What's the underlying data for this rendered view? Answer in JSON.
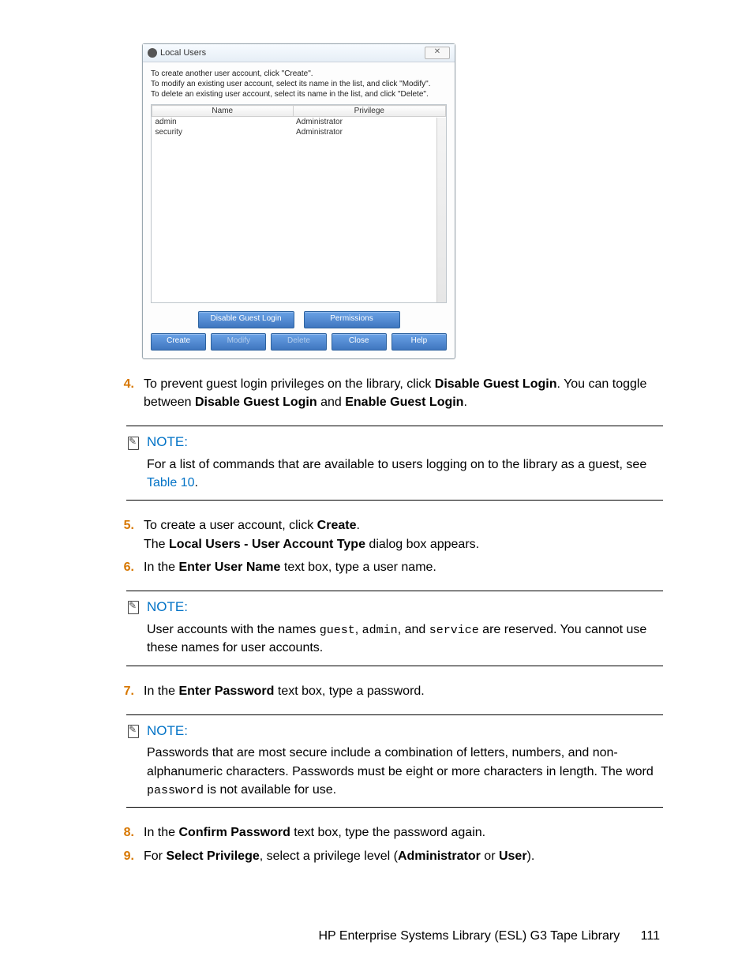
{
  "dialog": {
    "title": "Local Users",
    "close_glyph": "✕",
    "instructions": [
      "To create another user account, click \"Create\".",
      "To modify an existing user account, select its name in the list, and click \"Modify\".",
      "To delete an existing user account, select its name in the list, and click \"Delete\"."
    ],
    "headers": {
      "name": "Name",
      "privilege": "Privilege"
    },
    "rows": [
      {
        "name": "admin",
        "privilege": "Administrator"
      },
      {
        "name": "security",
        "privilege": "Administrator"
      }
    ],
    "buttons": {
      "disable_guest": "Disable Guest Login",
      "permissions": "Permissions",
      "create": "Create",
      "modify": "Modify",
      "delete": "Delete",
      "close": "Close",
      "help": "Help"
    }
  },
  "steps": {
    "s4": {
      "num": "4.",
      "pre": "To prevent guest login privileges on the library, click ",
      "b1": "Disable Guest Login",
      "mid1": ". You can toggle between ",
      "b2": "Disable Guest Login",
      "mid2": " and ",
      "b3": "Enable Guest Login",
      "end": "."
    },
    "s5": {
      "num": "5.",
      "line1_pre": "To create a user account, click ",
      "line1_b": "Create",
      "line1_end": ".",
      "line2_pre": "The ",
      "line2_b": "Local Users - User Account Type",
      "line2_end": " dialog box appears."
    },
    "s6": {
      "num": "6.",
      "pre": "In the ",
      "b": "Enter User Name",
      "end": " text box, type a user name."
    },
    "s7": {
      "num": "7.",
      "pre": "In the ",
      "b": "Enter Password",
      "end": " text box, type a password."
    },
    "s8": {
      "num": "8.",
      "pre": "In the ",
      "b": "Confirm Password",
      "end": " text box, type the password again."
    },
    "s9": {
      "num": "9.",
      "pre": "For ",
      "b1": "Select Privilege",
      "mid1": ", select a privilege level (",
      "b2": "Administrator",
      "mid2": " or ",
      "b3": "User",
      "end": ")."
    }
  },
  "notes": {
    "label": "NOTE:",
    "n1_pre": "For a list of commands that are available to users logging on to the library as a guest, see ",
    "n1_link": "Table 10",
    "n1_end": ".",
    "n2_pre": "User accounts with the names ",
    "n2_c1": "guest",
    "n2_s1": ", ",
    "n2_c2": "admin",
    "n2_s2": ", and ",
    "n2_c3": "service",
    "n2_end": " are reserved. You cannot use these names for user accounts.",
    "n3_pre": "Passwords that are most secure include a combination of letters, numbers, and non-alphanumeric characters. Passwords must be eight or more characters in length. The word ",
    "n3_code": "password",
    "n3_end": " is not available for use."
  },
  "footer": {
    "title": "HP Enterprise Systems Library (ESL) G3 Tape Library",
    "page": "111"
  }
}
